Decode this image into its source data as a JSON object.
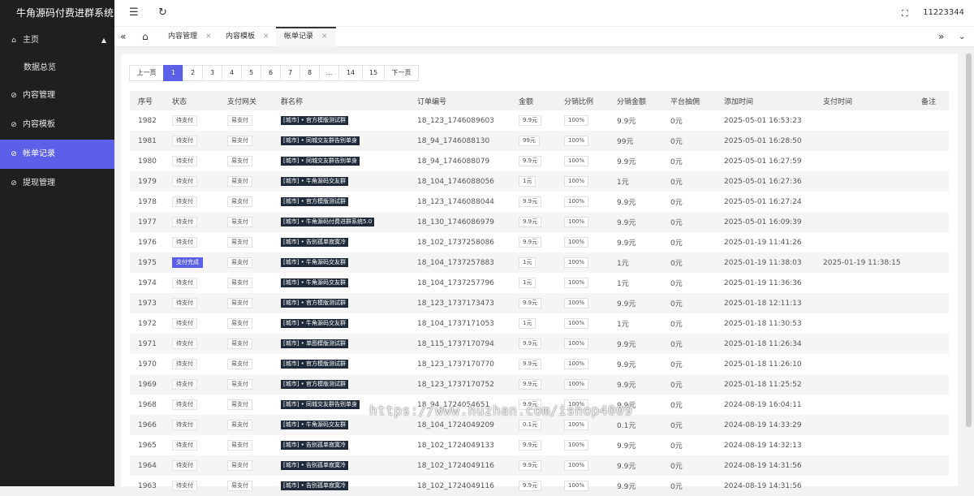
{
  "app": {
    "title": "牛角源码付费进群系统"
  },
  "sidebar": {
    "items": [
      {
        "label": "主页",
        "icon": "home-icon"
      },
      {
        "label": "数据总览"
      },
      {
        "label": "内容管理",
        "icon": "check-circle-icon"
      },
      {
        "label": "内容模板",
        "icon": "check-circle-icon"
      },
      {
        "label": "帐单记录",
        "icon": "check-circle-icon"
      },
      {
        "label": "提现管理",
        "icon": "check-circle-icon"
      }
    ]
  },
  "topbar": {
    "user": "11223344"
  },
  "tabs": [
    {
      "label": "内容管理"
    },
    {
      "label": "内容模板"
    },
    {
      "label": "帐单记录"
    }
  ],
  "pager": {
    "items": [
      "上一页",
      "1",
      "2",
      "3",
      "4",
      "5",
      "6",
      "7",
      "8",
      "...",
      "14",
      "15",
      "下一页"
    ],
    "current": "1"
  },
  "table": {
    "headers": [
      "序号",
      "状态",
      "支付网关",
      "群名称",
      "订单编号",
      "金额",
      "分销比例",
      "分销金额",
      "平台抽佣",
      "添加时间",
      "支付时间",
      "备注"
    ],
    "rows": [
      {
        "id": "1982",
        "status": "待支付",
        "gateway": "易支付",
        "group": "[城市] • 官方模版测试群",
        "order": "18_123_1746089603",
        "amount": "9.9元",
        "ratio": "100%",
        "dist": "9.9元",
        "fee": "0元",
        "added": "2025-05-01 16:53:23",
        "paid": "",
        "note": ""
      },
      {
        "id": "1981",
        "status": "待支付",
        "gateway": "易支付",
        "group": "[城市] • 同城交友群告别单身",
        "order": "18_94_1746088130",
        "amount": "99元",
        "ratio": "100%",
        "dist": "99元",
        "fee": "0元",
        "added": "2025-05-01 16:28:50",
        "paid": "",
        "note": ""
      },
      {
        "id": "1980",
        "status": "待支付",
        "gateway": "易支付",
        "group": "[城市] • 同城交友群告别单身",
        "order": "18_94_1746088079",
        "amount": "9.9元",
        "ratio": "100%",
        "dist": "9.9元",
        "fee": "0元",
        "added": "2025-05-01 16:27:59",
        "paid": "",
        "note": ""
      },
      {
        "id": "1979",
        "status": "待支付",
        "gateway": "易支付",
        "group": "[城市] • 牛角源码交友群",
        "order": "18_104_1746088056",
        "amount": "1元",
        "ratio": "100%",
        "dist": "1元",
        "fee": "0元",
        "added": "2025-05-01 16:27:36",
        "paid": "",
        "note": ""
      },
      {
        "id": "1978",
        "status": "待支付",
        "gateway": "易支付",
        "group": "[城市] • 官方模版测试群",
        "order": "18_123_1746088044",
        "amount": "9.9元",
        "ratio": "100%",
        "dist": "9.9元",
        "fee": "0元",
        "added": "2025-05-01 16:27:24",
        "paid": "",
        "note": ""
      },
      {
        "id": "1977",
        "status": "待支付",
        "gateway": "易支付",
        "group": "[城市] • 牛角源码付费进群系统5.0",
        "order": "18_130_1746086979",
        "amount": "9.9元",
        "ratio": "100%",
        "dist": "9.9元",
        "fee": "0元",
        "added": "2025-05-01 16:09:39",
        "paid": "",
        "note": ""
      },
      {
        "id": "1976",
        "status": "待支付",
        "gateway": "易支付",
        "group": "[城市] • 告别孤单寂寞冷",
        "order": "18_102_1737258086",
        "amount": "9.9元",
        "ratio": "100%",
        "dist": "9.9元",
        "fee": "0元",
        "added": "2025-01-19 11:41:26",
        "paid": "",
        "note": ""
      },
      {
        "id": "1975",
        "status": "支付完成",
        "gateway": "易支付",
        "group": "[城市] • 牛角源码交友群",
        "order": "18_104_1737257883",
        "amount": "1元",
        "ratio": "100%",
        "dist": "1元",
        "fee": "0元",
        "added": "2025-01-19 11:38:03",
        "paid": "2025-01-19 11:38:15",
        "note": ""
      },
      {
        "id": "1974",
        "status": "待支付",
        "gateway": "易支付",
        "group": "[城市] • 牛角源码交友群",
        "order": "18_104_1737257796",
        "amount": "1元",
        "ratio": "100%",
        "dist": "1元",
        "fee": "0元",
        "added": "2025-01-19 11:36:36",
        "paid": "",
        "note": ""
      },
      {
        "id": "1973",
        "status": "待支付",
        "gateway": "易支付",
        "group": "[城市] • 官方模版测试群",
        "order": "18_123_1737173473",
        "amount": "9.9元",
        "ratio": "100%",
        "dist": "9.9元",
        "fee": "0元",
        "added": "2025-01-18 12:11:13",
        "paid": "",
        "note": ""
      },
      {
        "id": "1972",
        "status": "待支付",
        "gateway": "易支付",
        "group": "[城市] • 牛角源码交友群",
        "order": "18_104_1737171053",
        "amount": "1元",
        "ratio": "100%",
        "dist": "1元",
        "fee": "0元",
        "added": "2025-01-18 11:30:53",
        "paid": "",
        "note": ""
      },
      {
        "id": "1971",
        "status": "待支付",
        "gateway": "易支付",
        "group": "[城市] • 单图模版测试群",
        "order": "18_115_1737170794",
        "amount": "9.9元",
        "ratio": "100%",
        "dist": "9.9元",
        "fee": "0元",
        "added": "2025-01-18 11:26:34",
        "paid": "",
        "note": ""
      },
      {
        "id": "1970",
        "status": "待支付",
        "gateway": "易支付",
        "group": "[城市] • 官方模版测试群",
        "order": "18_123_1737170770",
        "amount": "9.9元",
        "ratio": "100%",
        "dist": "9.9元",
        "fee": "0元",
        "added": "2025-01-18 11:26:10",
        "paid": "",
        "note": ""
      },
      {
        "id": "1969",
        "status": "待支付",
        "gateway": "易支付",
        "group": "[城市] • 官方模版测试群",
        "order": "18_123_1737170752",
        "amount": "9.9元",
        "ratio": "100%",
        "dist": "9.9元",
        "fee": "0元",
        "added": "2025-01-18 11:25:52",
        "paid": "",
        "note": ""
      },
      {
        "id": "1968",
        "status": "待支付",
        "gateway": "易支付",
        "group": "[城市] • 同城交友群告别单身",
        "order": "18_94_1724054651",
        "amount": "9.9元",
        "ratio": "100%",
        "dist": "9.9元",
        "fee": "0元",
        "added": "2024-08-19 16:04:11",
        "paid": "",
        "note": ""
      },
      {
        "id": "1966",
        "status": "待支付",
        "gateway": "易支付",
        "group": "[城市] • 牛角源码交友群",
        "order": "18_104_1724049209",
        "amount": "0.1元",
        "ratio": "100%",
        "dist": "0.1元",
        "fee": "0元",
        "added": "2024-08-19 14:33:29",
        "paid": "",
        "note": ""
      },
      {
        "id": "1965",
        "status": "待支付",
        "gateway": "易支付",
        "group": "[城市] • 告别孤单寂寞冷",
        "order": "18_102_1724049133",
        "amount": "9.9元",
        "ratio": "100%",
        "dist": "9.9元",
        "fee": "0元",
        "added": "2024-08-19 14:32:13",
        "paid": "",
        "note": ""
      },
      {
        "id": "1964",
        "status": "待支付",
        "gateway": "易支付",
        "group": "[城市] • 告别孤单寂寞冷",
        "order": "18_102_1724049116",
        "amount": "9.9元",
        "ratio": "100%",
        "dist": "9.9元",
        "fee": "0元",
        "added": "2024-08-19 14:31:56",
        "paid": "",
        "note": ""
      },
      {
        "id": "1963",
        "status": "待支付",
        "gateway": "易支付",
        "group": "[城市] • 告别孤单寂寞冷",
        "order": "18_102_1724049116",
        "amount": "9.9元",
        "ratio": "100%",
        "dist": "9.9元",
        "fee": "0元",
        "added": "2024-08-19 14:31:56",
        "paid": "",
        "note": ""
      }
    ]
  },
  "watermark": "https://www.huzhan.com/ishop4009",
  "colors": {
    "accent": "#5c5fe8",
    "sidebar": "#1f1f1f",
    "group_tag": "#1f2a3a"
  }
}
